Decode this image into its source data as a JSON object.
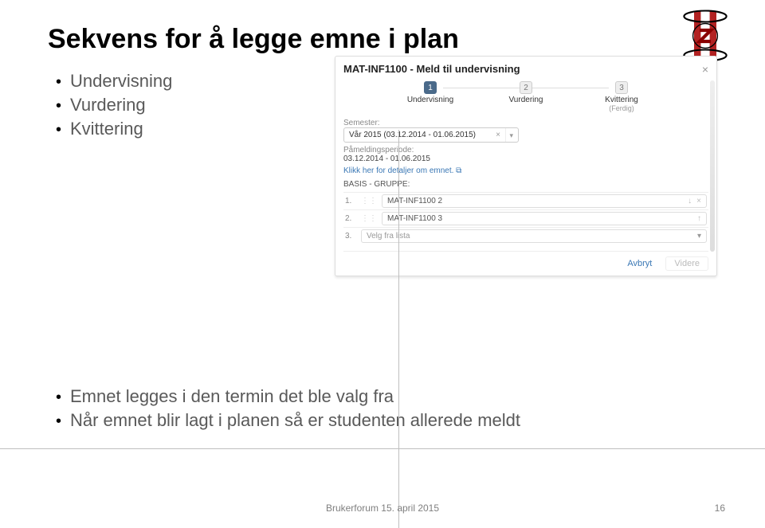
{
  "title": "Sekvens for å legge emne i plan",
  "bullets_top": [
    {
      "label": "Undervisning"
    },
    {
      "label": "Vurdering"
    },
    {
      "label": "Kvittering"
    }
  ],
  "bullets_bottom": [
    {
      "label": "Emnet legges i den termin det ble valg fra"
    },
    {
      "label": "Når emnet blir lagt i planen så er studenten allerede meldt"
    }
  ],
  "dialog": {
    "title": "MAT-INF1100 - Meld til undervisning",
    "steps": [
      {
        "num": "1",
        "label": "Undervisning",
        "sub": ""
      },
      {
        "num": "2",
        "label": "Vurdering",
        "sub": ""
      },
      {
        "num": "3",
        "label": "Kvittering",
        "sub": "(Ferdig)"
      }
    ],
    "semester_label": "Semester:",
    "semester_value": "Vår 2015 (03.12.2014 - 01.06.2015)",
    "registration_label": "Påmeldingsperiode:",
    "registration_value": "03.12.2014 - 01.06.2015",
    "details_link": "Klikk her for detaljer om emnet.",
    "group_label": "BASIS - GRUPPE:",
    "items": [
      {
        "num": "1.",
        "label": "MAT-INF1100 2"
      },
      {
        "num": "2.",
        "label": "MAT-INF1100 3"
      },
      {
        "num": "3.",
        "label": "Velg fra lista"
      }
    ],
    "cancel": "Avbryt",
    "next": "Videre"
  },
  "footer": {
    "text": "Brukerforum 15. april 2015",
    "page": "16"
  }
}
